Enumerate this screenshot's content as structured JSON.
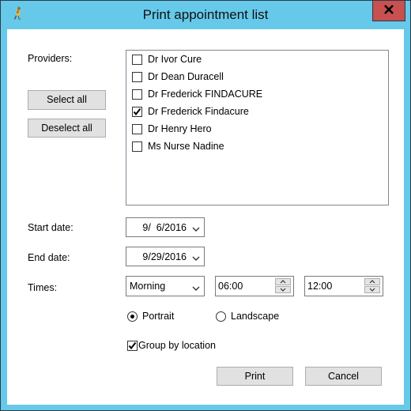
{
  "window": {
    "title": "Print appointment list",
    "app_icon": "finch-bird-icon",
    "close_label": "X",
    "frame_color": "#66c9ea",
    "close_color": "#c75050"
  },
  "providers": {
    "label": "Providers:",
    "select_all_label": "Select all",
    "deselect_all_label": "Deselect all",
    "items": [
      {
        "label": "Dr Ivor Cure",
        "checked": false
      },
      {
        "label": "Dr Dean Duracell",
        "checked": false
      },
      {
        "label": "Dr Frederick FINDACURE",
        "checked": false
      },
      {
        "label": "Dr Frederick Findacure",
        "checked": true
      },
      {
        "label": "Dr Henry Hero",
        "checked": false
      },
      {
        "label": "Ms Nurse Nadine",
        "checked": false
      }
    ]
  },
  "start_date": {
    "label": "Start date:",
    "value": "9/  6/2016"
  },
  "end_date": {
    "label": "End date:",
    "value": "9/29/2016"
  },
  "times": {
    "label": "Times:",
    "period_selected": "Morning",
    "start_time": "06:00",
    "end_time": "12:00"
  },
  "orientation": {
    "options": [
      {
        "label": "Portrait",
        "selected": true
      },
      {
        "label": "Landscape",
        "selected": false
      }
    ]
  },
  "group_by_location": {
    "label": "Group by location",
    "checked": true
  },
  "actions": {
    "print_label": "Print",
    "cancel_label": "Cancel"
  }
}
